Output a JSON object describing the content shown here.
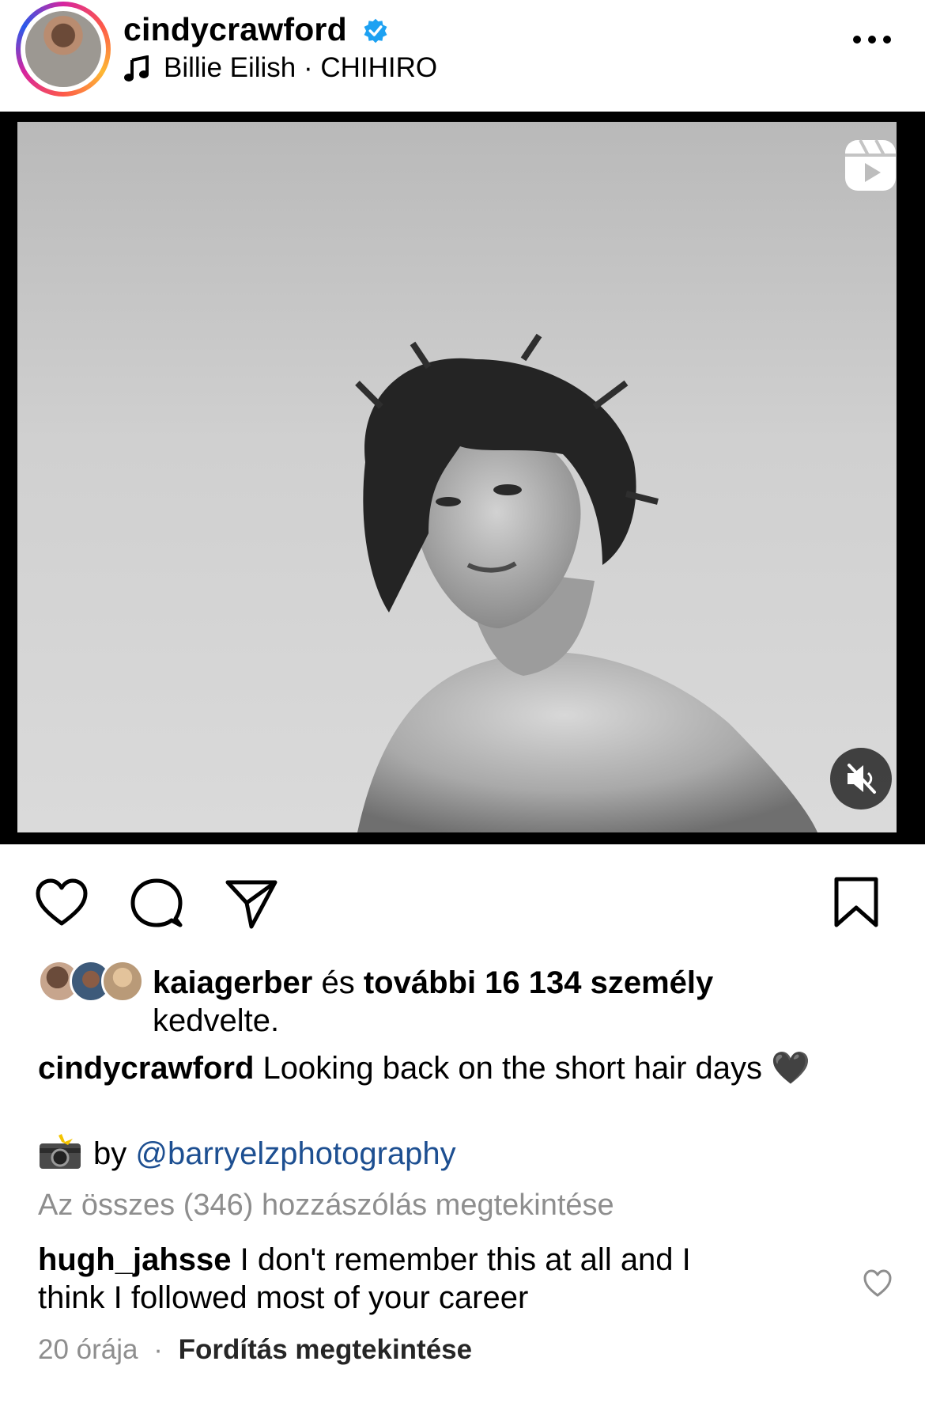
{
  "header": {
    "username": "cindycrawford",
    "audio": "Billie Eilish · CHIHIRO"
  },
  "likes": {
    "first_liker": "kaiagerber",
    "connector": " és ",
    "others": "további 16 134 személy",
    "suffix": "kedvelte."
  },
  "caption": {
    "username": "cindycrawford",
    "text": "Looking back on the short hair days",
    "emoji": "🖤"
  },
  "credit": {
    "prefix": "by ",
    "mention": "@barryelzphotography"
  },
  "view_all_comments": "Az összes (346) hozzászólás megtekintése",
  "top_comment": {
    "username": "hugh_jahsse",
    "text": "I don't remember this at all and I think I followed most of your career",
    "time": "20 órája",
    "separator": "·",
    "translate": "Fordítás megtekintése"
  },
  "colors": {
    "verified_blue": "#1da1f2",
    "mention_blue": "#1d4f91",
    "muted_gray": "#8e8e8e"
  },
  "icons": [
    "verified-badge-icon",
    "music-note-icon",
    "more-options-icon",
    "reels-icon",
    "muted-speaker-icon",
    "heart-icon",
    "comment-icon",
    "share-icon",
    "bookmark-icon",
    "camera-flash-icon",
    "small-heart-icon"
  ]
}
